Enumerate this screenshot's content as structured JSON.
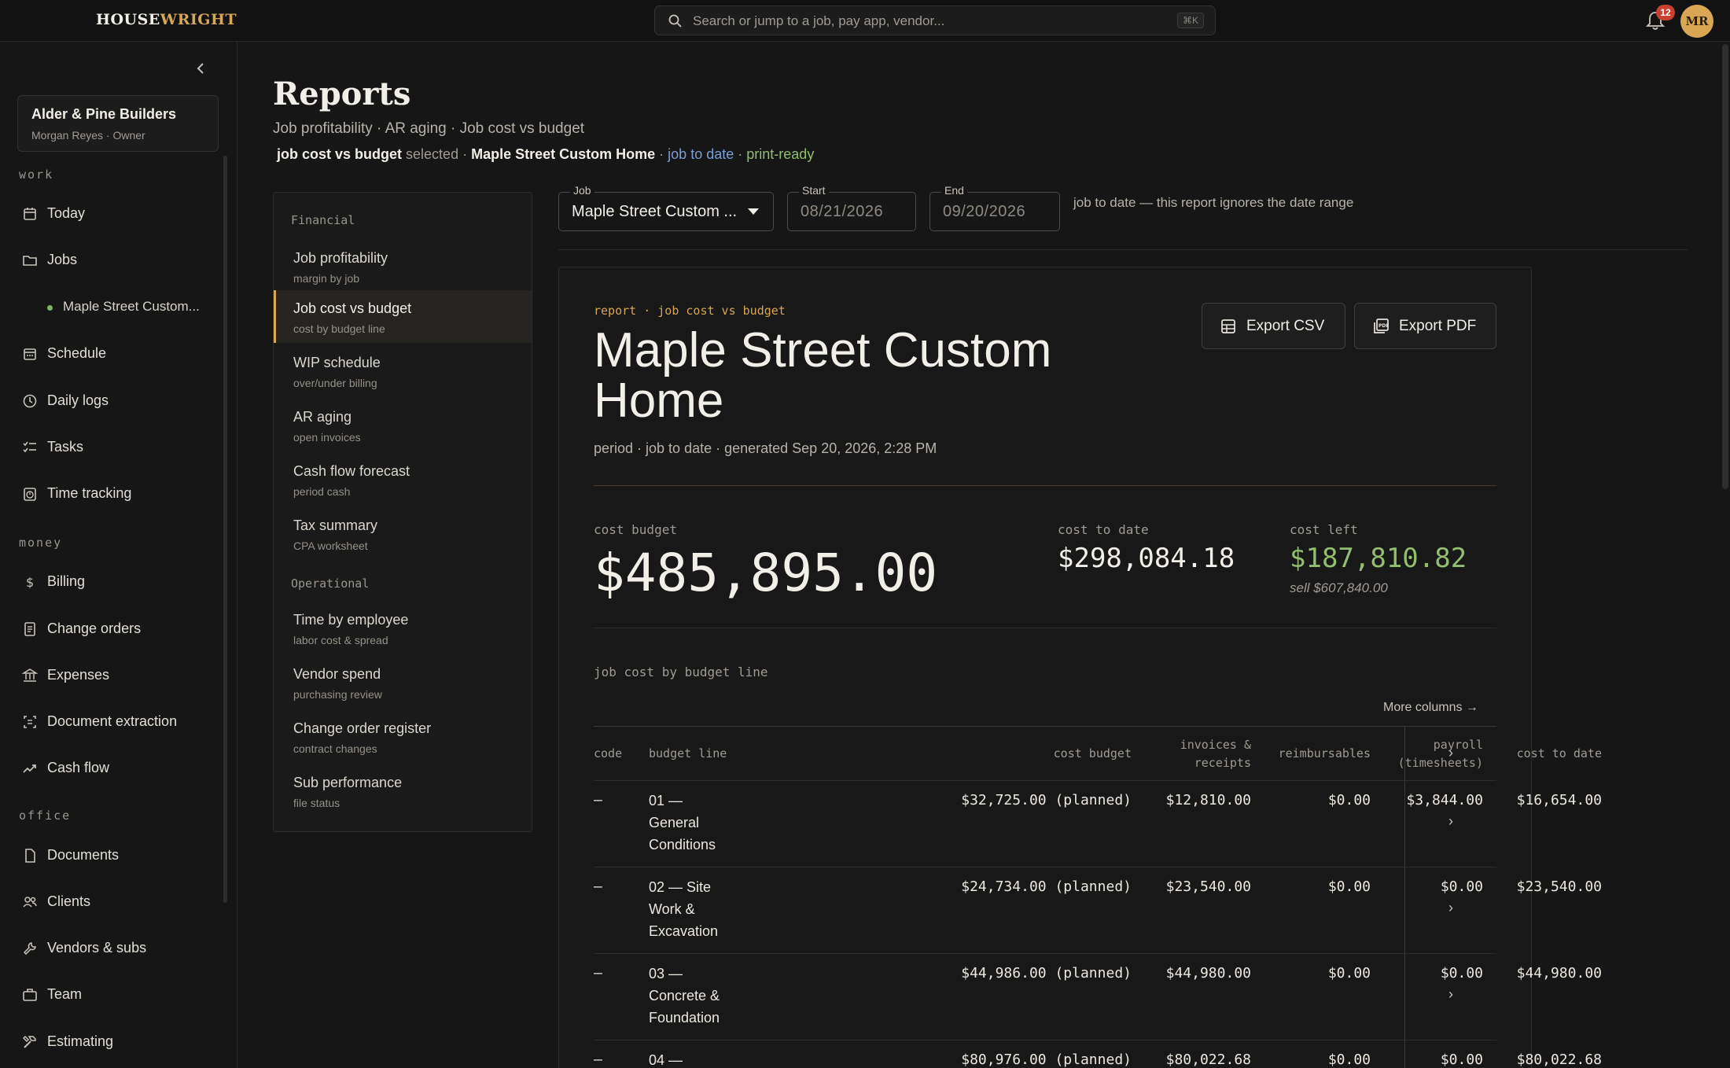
{
  "app": {
    "logo_part1": "HOUSE",
    "logo_part2": "WRIGHT",
    "search_placeholder": "Search or jump to a job, pay app, vendor...",
    "search_shortcut": "⌘K",
    "notification_count": "12",
    "avatar_initials": "MR",
    "accent_color": "#d9a653"
  },
  "sidebar": {
    "org_name": "Alder & Pine Builders",
    "org_user": "Morgan Reyes · Owner",
    "sections": {
      "work": "work",
      "money": "money",
      "office": "office"
    },
    "items": {
      "today": "Today",
      "jobs": "Jobs",
      "maple": "Maple Street Custom...",
      "schedule": "Schedule",
      "daily_logs": "Daily logs",
      "tasks": "Tasks",
      "time_tracking": "Time tracking",
      "billing": "Billing",
      "change_orders": "Change orders",
      "expenses": "Expenses",
      "document_extraction": "Document extraction",
      "cash_flow": "Cash flow",
      "documents": "Documents",
      "clients": "Clients",
      "vendors_subs": "Vendors & subs",
      "team": "Team",
      "estimating": "Estimating"
    }
  },
  "page": {
    "title": "Reports",
    "subtitle": "Job profitability · AR aging · Job cost vs budget",
    "status": {
      "report": "job cost vs budget",
      "selected": "selected ·",
      "job": "Maple Street Custom Home",
      "sep1": "·",
      "period": "job to date",
      "sep2": "·",
      "ready": "print-ready"
    }
  },
  "report_list": {
    "financial_label": "Financial",
    "operational_label": "Operational",
    "financial": [
      {
        "title": "Job profitability",
        "desc": "margin by job"
      },
      {
        "title": "Job cost vs budget",
        "desc": "cost by budget line"
      },
      {
        "title": "WIP schedule",
        "desc": "over/under billing"
      },
      {
        "title": "AR aging",
        "desc": "open invoices"
      },
      {
        "title": "Cash flow forecast",
        "desc": "period cash"
      },
      {
        "title": "Tax summary",
        "desc": "CPA worksheet"
      }
    ],
    "operational": [
      {
        "title": "Time by employee",
        "desc": "labor cost & spread"
      },
      {
        "title": "Vendor spend",
        "desc": "purchasing review"
      },
      {
        "title": "Change order register",
        "desc": "contract changes"
      },
      {
        "title": "Sub performance",
        "desc": "file status"
      }
    ]
  },
  "filters": {
    "job_label": "Job",
    "job_value": "Maple Street Custom ...",
    "start_label": "Start",
    "start_value": "08/21/2026",
    "end_label": "End",
    "end_value": "09/20/2026",
    "note": "job to date — this report ignores the date range"
  },
  "report": {
    "eyebrow": "report · job cost vs budget",
    "title": "Maple Street Custom Home",
    "meta": "period · job to date · generated Sep 20, 2026, 2:28 PM",
    "export_csv": "Export CSV",
    "export_pdf": "Export PDF",
    "kpis": {
      "cost_budget_label": "cost budget",
      "cost_budget": "$485,895.00",
      "cost_to_date_label": "cost to date",
      "cost_to_date": "$298,084.18",
      "cost_left_label": "cost left",
      "cost_left": "$187,810.82",
      "sell": "sell $607,840.00"
    },
    "table_caption": "job cost by budget line",
    "more_columns": "More columns →",
    "columns": {
      "code": "code",
      "budget_line": "budget line",
      "cost_budget": "cost budget",
      "invoices_1": "invoices &",
      "invoices_2": "receipts",
      "reimbursables": "reimbursables",
      "payroll_1": "payroll",
      "payroll_2": "(timesheets)",
      "cost_to_date": "cost to date",
      "expand": "›"
    },
    "rows": [
      {
        "code": "—",
        "line": "01 — General Conditions",
        "budget": "$32,725.00 (planned)",
        "invoices": "$12,810.00",
        "reimb": "$0.00",
        "payroll": "$3,844.00",
        "to_date": "$16,654.00",
        "chev": "›"
      },
      {
        "code": "—",
        "line": "02 — Site Work & Excavation",
        "budget": "$24,734.00 (planned)",
        "invoices": "$23,540.00",
        "reimb": "$0.00",
        "payroll": "$0.00",
        "to_date": "$23,540.00",
        "chev": "›"
      },
      {
        "code": "—",
        "line": "03 — Concrete & Foundation",
        "budget": "$44,986.00 (planned)",
        "invoices": "$44,980.00",
        "reimb": "$0.00",
        "payroll": "$0.00",
        "to_date": "$44,980.00",
        "chev": "›"
      },
      {
        "code": "—",
        "line": "04 —",
        "budget": "$80,976.00 (planned)",
        "invoices": "$80,022.68",
        "reimb": "$0.00",
        "payroll": "$0.00",
        "to_date": "$80,022.68",
        "chev": ""
      }
    ]
  }
}
